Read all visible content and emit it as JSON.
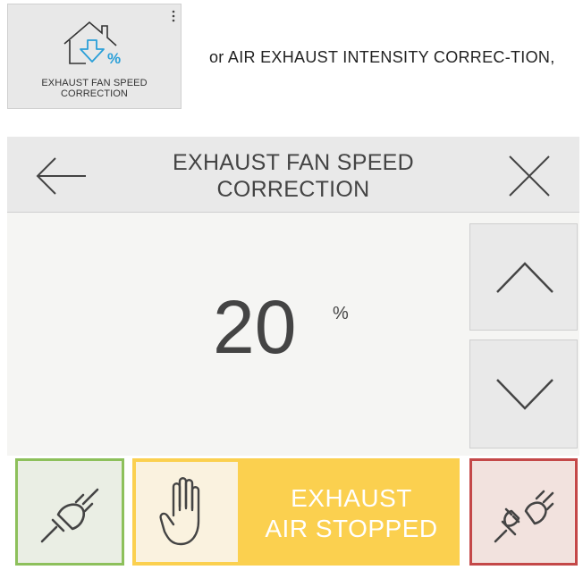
{
  "tile": {
    "label_line1": "EXHAUST FAN SPEED",
    "label_line2": "CORRECTION",
    "icon": "house-exhaust-percent-icon"
  },
  "caption": "or AIR EXHAUST INTENSITY CORREC-TION,",
  "header": {
    "title_line1": "EXHAUST FAN SPEED",
    "title_line2": "CORRECTION",
    "back_icon": "arrow-left-icon",
    "close_icon": "close-icon"
  },
  "value": {
    "number": "20",
    "unit": "%"
  },
  "controls": {
    "up_icon": "chevron-up-icon",
    "down_icon": "chevron-down-icon",
    "connect_icon": "plug-connected-icon",
    "stop_icon": "hand-stop-icon",
    "status_line1": "EXHAUST",
    "status_line2": "AIR STOPPED",
    "disconnect_icon": "plug-disconnected-icon"
  },
  "colors": {
    "connect_border": "#8dc05b",
    "status_bg": "#fbd04f",
    "disconnect_border": "#c44848",
    "icon_accent": "#2a9fd8"
  }
}
